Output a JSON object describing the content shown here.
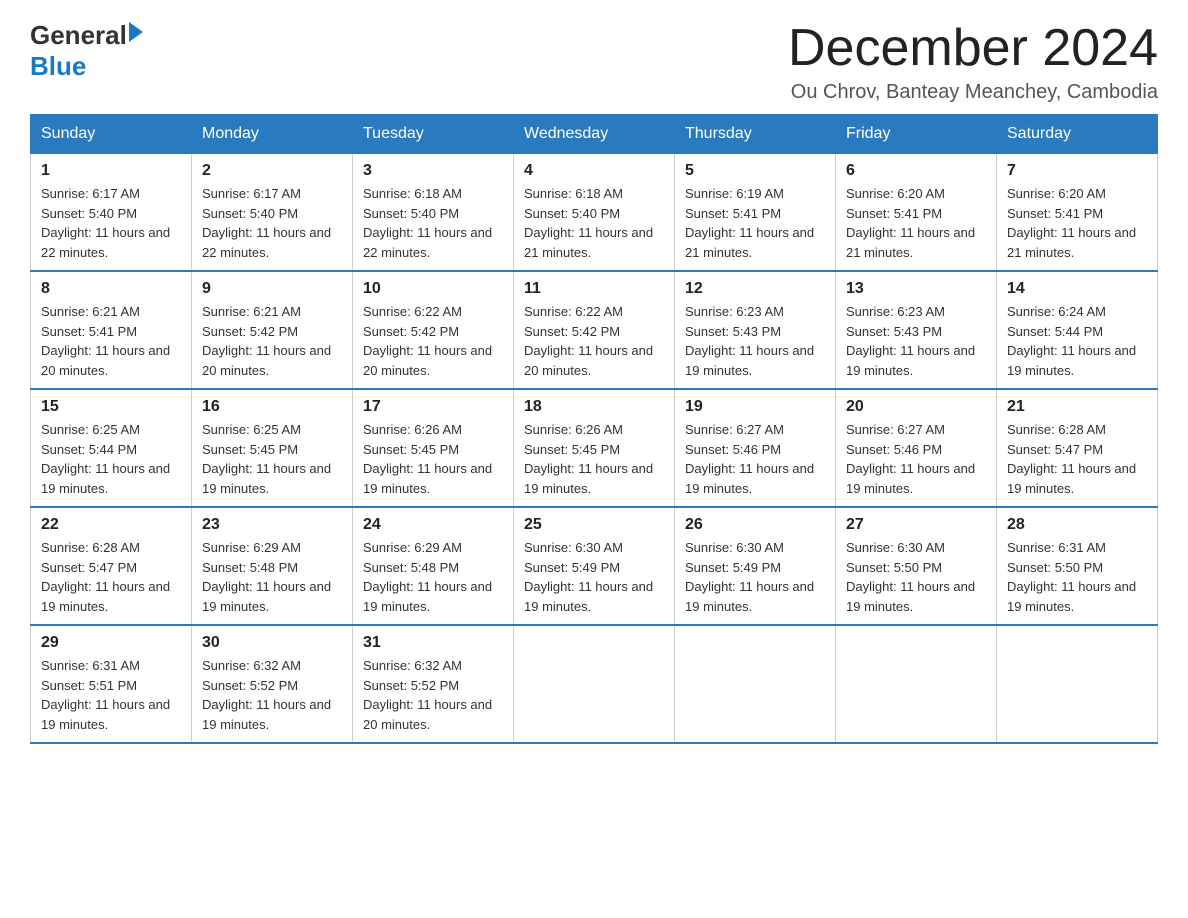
{
  "header": {
    "logo": {
      "general": "General",
      "triangle": "",
      "blue": "Blue"
    },
    "title": "December 2024",
    "subtitle": "Ou Chrov, Banteay Meanchey, Cambodia"
  },
  "weekdays": [
    "Sunday",
    "Monday",
    "Tuesday",
    "Wednesday",
    "Thursday",
    "Friday",
    "Saturday"
  ],
  "weeks": [
    [
      {
        "day": "1",
        "sunrise": "6:17 AM",
        "sunset": "5:40 PM",
        "daylight": "11 hours and 22 minutes."
      },
      {
        "day": "2",
        "sunrise": "6:17 AM",
        "sunset": "5:40 PM",
        "daylight": "11 hours and 22 minutes."
      },
      {
        "day": "3",
        "sunrise": "6:18 AM",
        "sunset": "5:40 PM",
        "daylight": "11 hours and 22 minutes."
      },
      {
        "day": "4",
        "sunrise": "6:18 AM",
        "sunset": "5:40 PM",
        "daylight": "11 hours and 21 minutes."
      },
      {
        "day": "5",
        "sunrise": "6:19 AM",
        "sunset": "5:41 PM",
        "daylight": "11 hours and 21 minutes."
      },
      {
        "day": "6",
        "sunrise": "6:20 AM",
        "sunset": "5:41 PM",
        "daylight": "11 hours and 21 minutes."
      },
      {
        "day": "7",
        "sunrise": "6:20 AM",
        "sunset": "5:41 PM",
        "daylight": "11 hours and 21 minutes."
      }
    ],
    [
      {
        "day": "8",
        "sunrise": "6:21 AM",
        "sunset": "5:41 PM",
        "daylight": "11 hours and 20 minutes."
      },
      {
        "day": "9",
        "sunrise": "6:21 AM",
        "sunset": "5:42 PM",
        "daylight": "11 hours and 20 minutes."
      },
      {
        "day": "10",
        "sunrise": "6:22 AM",
        "sunset": "5:42 PM",
        "daylight": "11 hours and 20 minutes."
      },
      {
        "day": "11",
        "sunrise": "6:22 AM",
        "sunset": "5:42 PM",
        "daylight": "11 hours and 20 minutes."
      },
      {
        "day": "12",
        "sunrise": "6:23 AM",
        "sunset": "5:43 PM",
        "daylight": "11 hours and 19 minutes."
      },
      {
        "day": "13",
        "sunrise": "6:23 AM",
        "sunset": "5:43 PM",
        "daylight": "11 hours and 19 minutes."
      },
      {
        "day": "14",
        "sunrise": "6:24 AM",
        "sunset": "5:44 PM",
        "daylight": "11 hours and 19 minutes."
      }
    ],
    [
      {
        "day": "15",
        "sunrise": "6:25 AM",
        "sunset": "5:44 PM",
        "daylight": "11 hours and 19 minutes."
      },
      {
        "day": "16",
        "sunrise": "6:25 AM",
        "sunset": "5:45 PM",
        "daylight": "11 hours and 19 minutes."
      },
      {
        "day": "17",
        "sunrise": "6:26 AM",
        "sunset": "5:45 PM",
        "daylight": "11 hours and 19 minutes."
      },
      {
        "day": "18",
        "sunrise": "6:26 AM",
        "sunset": "5:45 PM",
        "daylight": "11 hours and 19 minutes."
      },
      {
        "day": "19",
        "sunrise": "6:27 AM",
        "sunset": "5:46 PM",
        "daylight": "11 hours and 19 minutes."
      },
      {
        "day": "20",
        "sunrise": "6:27 AM",
        "sunset": "5:46 PM",
        "daylight": "11 hours and 19 minutes."
      },
      {
        "day": "21",
        "sunrise": "6:28 AM",
        "sunset": "5:47 PM",
        "daylight": "11 hours and 19 minutes."
      }
    ],
    [
      {
        "day": "22",
        "sunrise": "6:28 AM",
        "sunset": "5:47 PM",
        "daylight": "11 hours and 19 minutes."
      },
      {
        "day": "23",
        "sunrise": "6:29 AM",
        "sunset": "5:48 PM",
        "daylight": "11 hours and 19 minutes."
      },
      {
        "day": "24",
        "sunrise": "6:29 AM",
        "sunset": "5:48 PM",
        "daylight": "11 hours and 19 minutes."
      },
      {
        "day": "25",
        "sunrise": "6:30 AM",
        "sunset": "5:49 PM",
        "daylight": "11 hours and 19 minutes."
      },
      {
        "day": "26",
        "sunrise": "6:30 AM",
        "sunset": "5:49 PM",
        "daylight": "11 hours and 19 minutes."
      },
      {
        "day": "27",
        "sunrise": "6:30 AM",
        "sunset": "5:50 PM",
        "daylight": "11 hours and 19 minutes."
      },
      {
        "day": "28",
        "sunrise": "6:31 AM",
        "sunset": "5:50 PM",
        "daylight": "11 hours and 19 minutes."
      }
    ],
    [
      {
        "day": "29",
        "sunrise": "6:31 AM",
        "sunset": "5:51 PM",
        "daylight": "11 hours and 19 minutes."
      },
      {
        "day": "30",
        "sunrise": "6:32 AM",
        "sunset": "5:52 PM",
        "daylight": "11 hours and 19 minutes."
      },
      {
        "day": "31",
        "sunrise": "6:32 AM",
        "sunset": "5:52 PM",
        "daylight": "11 hours and 20 minutes."
      },
      null,
      null,
      null,
      null
    ]
  ],
  "labels": {
    "sunrise": "Sunrise:",
    "sunset": "Sunset:",
    "daylight": "Daylight:"
  }
}
